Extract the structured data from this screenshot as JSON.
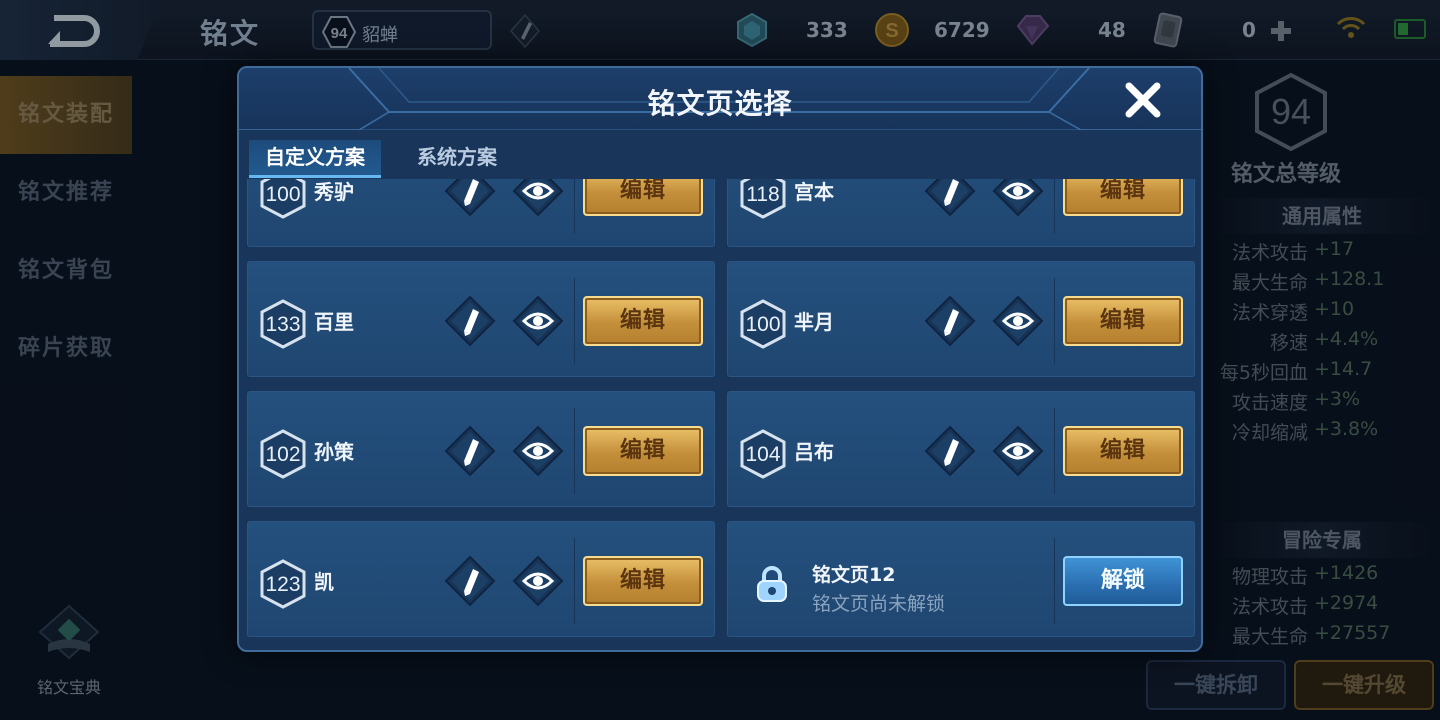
{
  "top_bar": {
    "title": "铭文",
    "hero_level": "94",
    "hero_name": "貂蝉",
    "resources": [
      {
        "icon": "gem-icon",
        "value": "333"
      },
      {
        "icon": "gold-coin-icon",
        "value": "6729"
      },
      {
        "icon": "crystal-icon",
        "value": "48"
      },
      {
        "icon": "card-icon",
        "value": "0"
      }
    ]
  },
  "sidebar": {
    "items": [
      "铭文装配",
      "铭文推荐",
      "铭文背包",
      "碎片获取"
    ],
    "codex_label": "铭文宝典"
  },
  "right_panel": {
    "total_level": "94",
    "total_level_label": "铭文总等级",
    "general_header": "通用属性",
    "general_stats": [
      {
        "name": "法术攻击",
        "value": "+17"
      },
      {
        "name": "最大生命",
        "value": "+128.1"
      },
      {
        "name": "法术穿透",
        "value": "+10"
      },
      {
        "name": "移速",
        "value": "+4.4%"
      },
      {
        "name": "每5秒回血",
        "value": "+14.7"
      },
      {
        "name": "攻击速度",
        "value": "+3%"
      },
      {
        "name": "冷却缩减",
        "value": "+3.8%"
      }
    ],
    "adventure_header": "冒险专属",
    "adventure_stats": [
      {
        "name": "物理攻击",
        "value": "+1426"
      },
      {
        "name": "法术攻击",
        "value": "+2974"
      },
      {
        "name": "最大生命",
        "value": "+27557"
      }
    ],
    "dismantle_label": "一键拆卸",
    "upgrade_label": "一键升级"
  },
  "modal": {
    "title": "铭文页选择",
    "tabs": [
      "自定义方案",
      "系统方案"
    ],
    "edit_label": "编辑",
    "pages": [
      {
        "level": "100",
        "name": "秀驴"
      },
      {
        "level": "118",
        "name": "宫本"
      },
      {
        "level": "133",
        "name": "百里"
      },
      {
        "level": "100",
        "name": "芈月"
      },
      {
        "level": "102",
        "name": "孙策"
      },
      {
        "level": "104",
        "name": "吕布"
      },
      {
        "level": "123",
        "name": "凯"
      }
    ],
    "locked_page": {
      "title": "铭文页12",
      "subtitle": "铭文页尚未解锁",
      "unlock_label": "解锁"
    }
  }
}
